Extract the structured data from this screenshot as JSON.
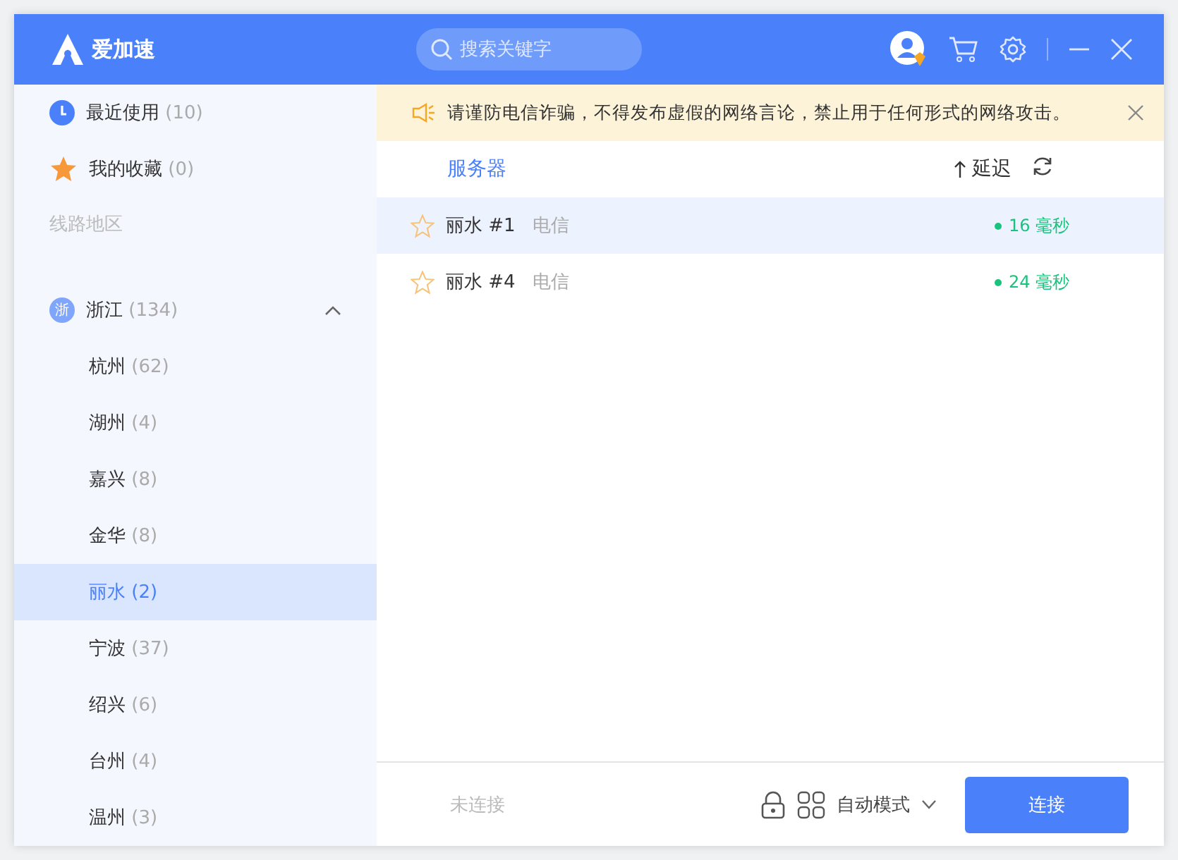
{
  "app": {
    "name": "爱加速"
  },
  "search": {
    "placeholder": "搜索关键字"
  },
  "sidebar": {
    "quick": [
      {
        "kind": "recent",
        "label": "最近使用",
        "count": "(10)"
      },
      {
        "kind": "favorites",
        "label": "我的收藏",
        "count": "(0)"
      }
    ],
    "section_label": "线路地区",
    "regions": [
      {
        "badge": "浙",
        "label": "浙江",
        "count": "(134)",
        "expanded": true,
        "children": [
          {
            "label": "杭州",
            "count": "(62)",
            "selected": false
          },
          {
            "label": "湖州",
            "count": "(4)",
            "selected": false
          },
          {
            "label": "嘉兴",
            "count": "(8)",
            "selected": false
          },
          {
            "label": "金华",
            "count": "(8)",
            "selected": false
          },
          {
            "label": "丽水",
            "count": "(2)",
            "selected": true
          },
          {
            "label": "宁波",
            "count": "(37)",
            "selected": false
          },
          {
            "label": "绍兴",
            "count": "(6)",
            "selected": false
          },
          {
            "label": "台州",
            "count": "(4)",
            "selected": false
          },
          {
            "label": "温州",
            "count": "(3)",
            "selected": false
          }
        ]
      }
    ]
  },
  "notice": {
    "text": "请谨防电信诈骗，不得发布虚假的网络言论，禁止用于任何形式的网络攻击。"
  },
  "table": {
    "columns": [
      "服务器",
      "延迟"
    ],
    "rows": [
      {
        "name": "丽水 #1",
        "carrier": "电信",
        "latency": "16 毫秒",
        "favorite": false,
        "selected": true,
        "color": "#19c37d"
      },
      {
        "name": "丽水 #4",
        "carrier": "电信",
        "latency": "24 毫秒",
        "favorite": false,
        "selected": false,
        "color": "#19c37d"
      }
    ]
  },
  "footer": {
    "status": "未连接",
    "locked": true,
    "mode": "自动模式",
    "connect_button": "连接"
  }
}
